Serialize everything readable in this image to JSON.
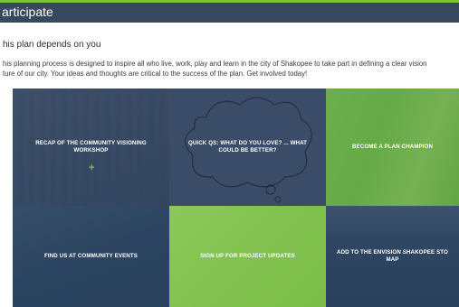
{
  "header": {
    "title": "articipate"
  },
  "subtitle": "his plan depends on you",
  "intro": {
    "line1": "his planning process is designed to inspire all who live, work, play and learn in the city of Shakopee to take part in defining a clear vision",
    "line2": "ture of our city. Your ideas and thoughts are critical to the success of the plan. Get involved today!"
  },
  "tiles": [
    {
      "label": "RECAP OF THE COMMUNITY VISIONING WORKSHOP",
      "icon": "plus-icon"
    },
    {
      "label": "QUICK QS: WHAT DO YOU LOVE? ... WHAT COULD BE BETTER?",
      "icon": "speech-bubble-icon"
    },
    {
      "label": "BECOME A PLAN CHAMPION"
    },
    {
      "label": "FIND US AT COMMUNITY EVENTS"
    },
    {
      "label": "SIGN UP FOR PROJECT UPDATES"
    },
    {
      "label": "ADD TO THE ENVISION SHAKOPEE STO MAP"
    }
  ],
  "colors": {
    "accent_green": "#7cc143",
    "header_navy": "#36485d",
    "tile_navy": "#3a4c67"
  }
}
